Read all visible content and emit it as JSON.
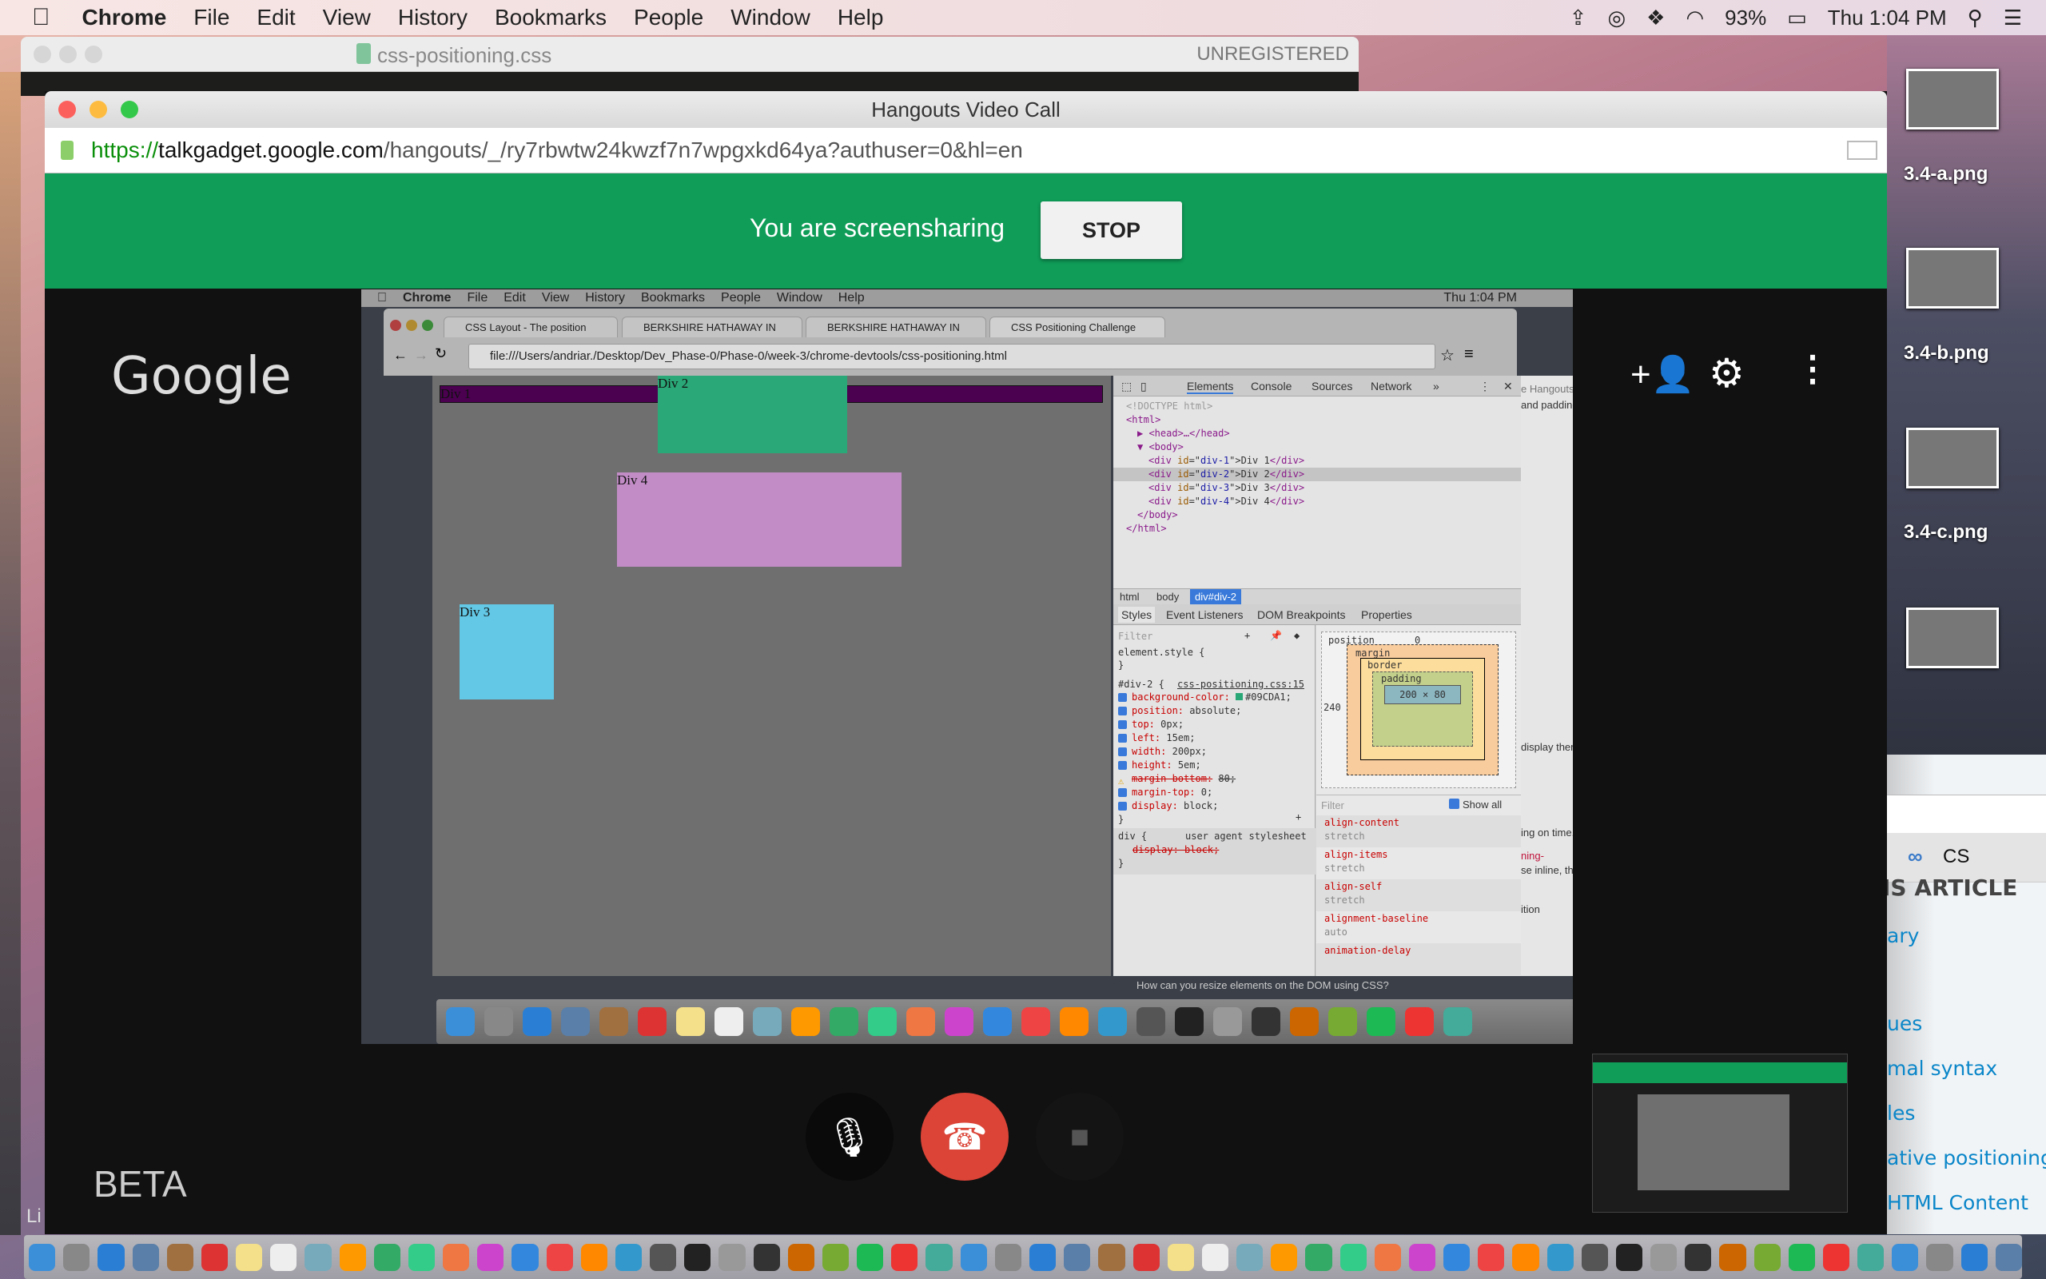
{
  "menubar": {
    "app": "Chrome",
    "items": [
      "File",
      "Edit",
      "View",
      "History",
      "Bookmarks",
      "People",
      "Window",
      "Help"
    ],
    "battery": "93%",
    "clock": "Thu 1:04 PM"
  },
  "sublime": {
    "title": "css-positioning.css",
    "status": "UNREGISTERED"
  },
  "hangouts": {
    "window_title": "Hangouts Video Call",
    "url_scheme": "https://",
    "url_host": "talkgadget.google.com",
    "url_path": "/hangouts/_/ry7rbwtw24kwzf7n7wpgxkd64ya?authuser=0&hl=en",
    "banner_text": "You are screensharing",
    "stop_label": "STOP",
    "logo": "Google",
    "beta": "BETA",
    "accent": "#0f9d58",
    "hangup_color": "#db4437"
  },
  "shared": {
    "menubar": {
      "app": "Chrome",
      "items": [
        "File",
        "Edit",
        "View",
        "History",
        "Bookmarks",
        "People",
        "Window",
        "Help"
      ],
      "clock": "Thu 1:04 PM"
    },
    "tabs": [
      "CSS Layout - The position",
      "BERKSHIRE HATHAWAY IN",
      "BERKSHIRE HATHAWAY IN",
      "CSS Positioning Challenge"
    ],
    "address": "file:///Users/andriar./Desktop/Dev_Phase-0/Phase-0/week-3/chrome-devtools/css-positioning.html",
    "divs": [
      {
        "label": "Div 1",
        "color": "#4b0050"
      },
      {
        "label": "Div 2",
        "color": "#2aa877"
      },
      {
        "label": "Div 3",
        "color": "#62c8e6"
      },
      {
        "label": "Div 4",
        "color": "#c28cc6"
      }
    ],
    "devtools": {
      "tabs": [
        "Elements",
        "Console",
        "Sources",
        "Network",
        "»"
      ],
      "dom": {
        "doctype": "<!DOCTYPE html>",
        "html_open": "<html>",
        "head": "<head>…</head>",
        "body_open": "<body>",
        "divs": [
          {
            "id": "div-1",
            "text": "Div 1"
          },
          {
            "id": "div-2",
            "text": "Div 2"
          },
          {
            "id": "div-3",
            "text": "Div 3"
          },
          {
            "id": "div-4",
            "text": "Div 4"
          }
        ],
        "body_close": "</body>",
        "html_close": "</html>"
      },
      "breadcrumbs": [
        "html",
        "body",
        "div#div-2"
      ],
      "subtabs": [
        "Styles",
        "Event Listeners",
        "DOM Breakpoints",
        "Properties"
      ],
      "filter_placeholder": "Filter",
      "element_style": "element.style {",
      "rule_selector": "#div-2 {",
      "rule_source": "css-positioning.css:15",
      "declarations": [
        {
          "text": "background-color:",
          "value": "#09CDA1;",
          "checked": true
        },
        {
          "text": "position:",
          "value": "absolute;",
          "checked": true
        },
        {
          "text": "top:",
          "value": "0px;",
          "checked": true
        },
        {
          "text": "left:",
          "value": "15em;",
          "checked": true
        },
        {
          "text": "width:",
          "value": "200px;",
          "checked": true
        },
        {
          "text": "height:",
          "value": "5em;",
          "checked": true
        },
        {
          "text": "margin-bottom:",
          "value": "80;",
          "checked": false,
          "warning": true
        },
        {
          "text": "margin-top:",
          "value": "0;",
          "checked": true
        },
        {
          "text": "display:",
          "value": "block;",
          "checked": true
        }
      ],
      "ua_selector": "div {",
      "ua_label": "user agent stylesheet",
      "ua_decl": "display: block;",
      "boxmodel": {
        "position_label": "position",
        "position_value": "0",
        "margin": "margin",
        "border": "border",
        "padding": "padding",
        "content": "200 × 80",
        "left": "240",
        "dash": "-"
      },
      "computed_filter": "Filter",
      "show_all": "Show all",
      "computed": [
        {
          "prop": "align-content",
          "value": "stretch"
        },
        {
          "prop": "align-items",
          "value": "stretch"
        },
        {
          "prop": "align-self",
          "value": "stretch"
        },
        {
          "prop": "alignment-baseline",
          "value": "auto"
        },
        {
          "prop": "animation-delay",
          "value": ""
        }
      ]
    },
    "side_text": [
      "e Hangouts",
      "and padding",
      "display them",
      "ing on time.",
      "ning-",
      "se inline, then",
      "ition",
      "How can you resize elements on the DOM using CSS?"
    ]
  },
  "desktop": {
    "files": [
      "3.4-a.png",
      "3.4-b.png",
      "3.4-c.png"
    ],
    "article_tab": "CS",
    "article_heading": "IS ARTICLE",
    "article_links": [
      "ary",
      "ues",
      "mal syntax",
      "les",
      "ative positioning",
      "HTML Content"
    ],
    "left_text": "Li"
  }
}
